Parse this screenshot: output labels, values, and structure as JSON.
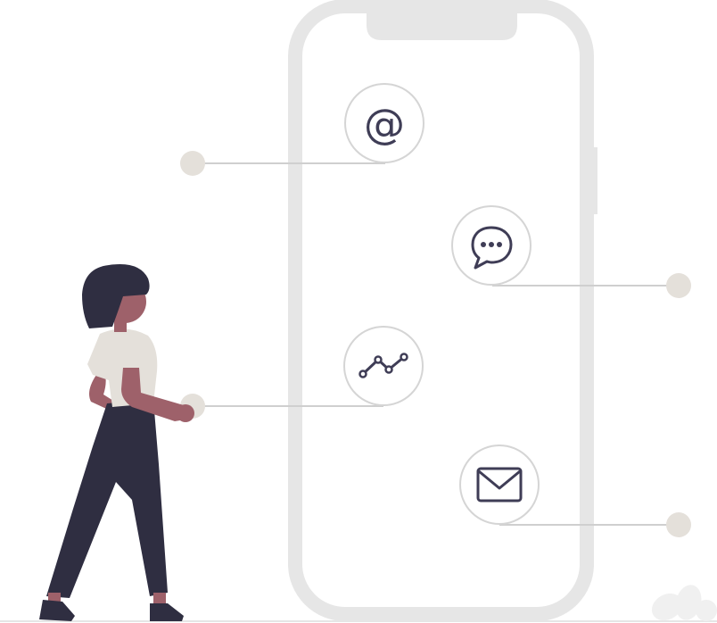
{
  "colors": {
    "phone_frame": "#e6e6e6",
    "dot": "#e4e0da",
    "icon_ring": "#d5d5d5",
    "connector_line": "#cfcfcf",
    "icon_stroke": "#3f3d56",
    "skin": "#9e616a",
    "hair_and_pants": "#2f2e41",
    "shirt": "#e4e0da",
    "plant": "#f0f0f0"
  },
  "icons": [
    {
      "name": "at-sign-icon",
      "glyph": "@"
    },
    {
      "name": "chat-bubble-icon"
    },
    {
      "name": "trend-line-icon"
    },
    {
      "name": "envelope-icon"
    }
  ]
}
